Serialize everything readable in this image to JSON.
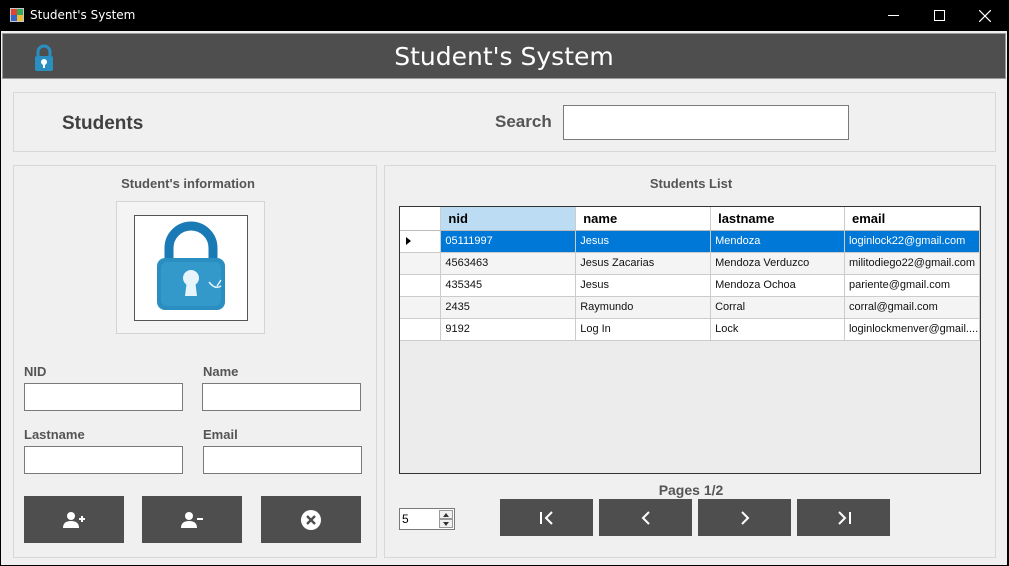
{
  "window": {
    "title": "Student's System"
  },
  "header": {
    "title": "Student's System"
  },
  "top": {
    "students_label": "Students",
    "search_label": "Search",
    "search_value": ""
  },
  "info": {
    "title": "Student's information",
    "nid_label": "NID",
    "name_label": "Name",
    "lastname_label": "Lastname",
    "email_label": "Email",
    "buttons": [
      "add-user-icon",
      "remove-user-icon",
      "cancel-icon"
    ]
  },
  "list": {
    "title": "Students List",
    "columns": [
      "nid",
      "name",
      "lastname",
      "email"
    ],
    "rows": [
      [
        "05111997",
        "Jesus",
        "Mendoza",
        "loginlock22@gmail.com"
      ],
      [
        "4563463",
        "Jesus Zacarias",
        "Mendoza Verduzco",
        "militodiego22@gmail.com"
      ],
      [
        "435345",
        "Jesus",
        "Mendoza Ochoa",
        "pariente@gmail.com"
      ],
      [
        "2435",
        "Raymundo",
        "Corral",
        "corral@gmail.com"
      ],
      [
        "9192",
        "Log In",
        "Lock",
        "loginlockmenver@gmail...."
      ]
    ],
    "selected_row": 0
  },
  "pagination": {
    "label": "Pages 1/2",
    "page_size": "5"
  },
  "colors": {
    "header_bg": "#4e4e4e",
    "selection": "#0078d7",
    "button_bg": "#4e4e4e"
  }
}
